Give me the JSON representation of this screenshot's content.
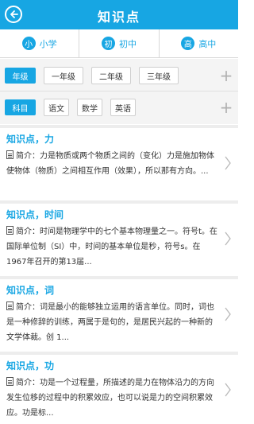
{
  "header": {
    "title": "知识点"
  },
  "levels": [
    {
      "badge": "小",
      "label": "小学"
    },
    {
      "badge": "初",
      "label": "初中"
    },
    {
      "badge": "高",
      "label": "高中"
    }
  ],
  "filters": {
    "grade": {
      "tag": "年级",
      "options": [
        "一年级",
        "二年级",
        "三年级"
      ]
    },
    "subject": {
      "tag": "科目",
      "options": [
        "语文",
        "数学",
        "英语"
      ]
    }
  },
  "items": [
    {
      "title": "知识点，力",
      "text": "简介：力是物质或两个物质之间的（变化）力是施加物体使物体（物质）之间相互作用（效果），所以那有方向。..."
    },
    {
      "title": "知识点，时间",
      "text": "简介：时间是物理学中的七个基本物理量之一。符号t。在国际单位制（SI）中，时间的基本单位是秒，符号s。在1967年召开的第13届..."
    },
    {
      "title": "知识点，词",
      "text": "简介：词是最小的能够独立运用的语言单位。同时，词也是一种修辞的训练，两属于是句的，是居民兴起的一种新的文学体裁。创 1..."
    },
    {
      "title": "知识点，功",
      "text": "简介：功是一个过程量，所描述的是力在物体沿力的方向发生位移的过程中的积累效应，也可以说是力的空间积累效应。功是标..."
    }
  ]
}
